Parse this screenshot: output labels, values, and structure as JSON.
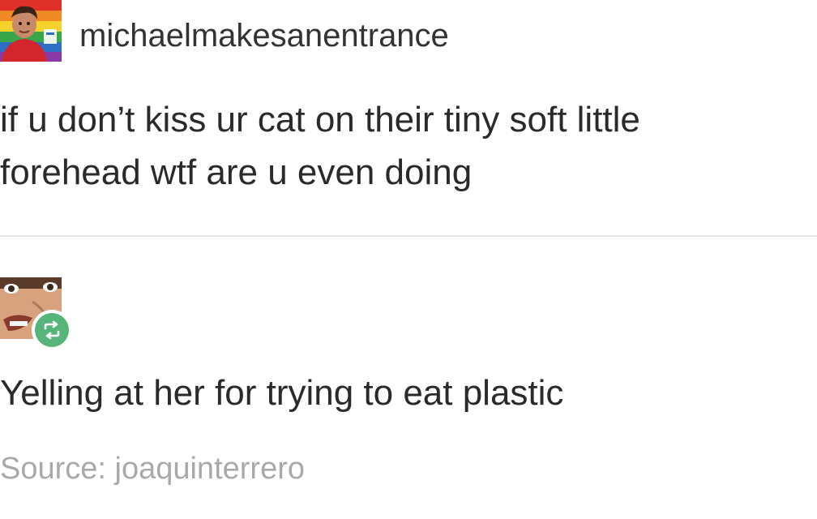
{
  "posts": [
    {
      "username": "michaelmakesanentrance",
      "avatar_icon": "profile-photo-pride-flag",
      "text_lines": [
        "if u don’t kiss ur cat on their tiny soft little",
        "forehead wtf are u even doing"
      ]
    },
    {
      "avatar_icon": "profile-photo-face",
      "badge_icon": "reblog-icon",
      "badge_color": "#56b57a",
      "text": "Yelling at her for trying to eat plastic"
    }
  ],
  "source": {
    "text": "Source: joaquinterrero"
  }
}
